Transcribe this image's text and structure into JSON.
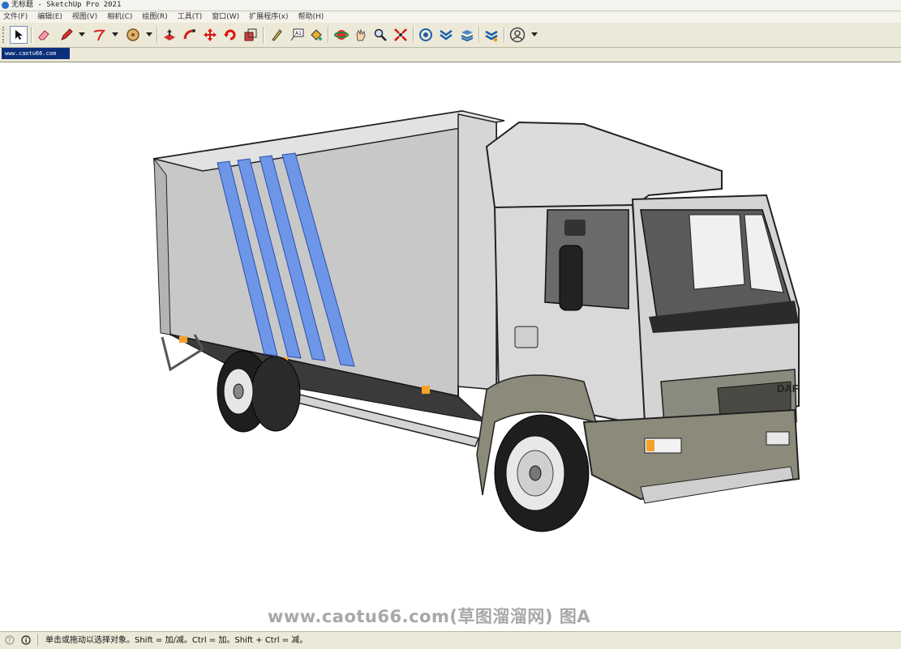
{
  "window": {
    "title": "无标题 - SketchUp Pro 2021"
  },
  "menu": [
    "文件(F)",
    "编辑(E)",
    "视图(V)",
    "相机(C)",
    "绘图(R)",
    "工具(T)",
    "窗口(W)",
    "扩展程序(x)",
    "帮助(H)"
  ],
  "toolbar": {
    "tools": [
      "select-icon",
      "eraser-icon",
      "pencil-icon",
      "arc-icon",
      "circle-icon",
      "push-pull-icon",
      "follow-me-icon",
      "move-icon",
      "rotate-icon",
      "scale-icon",
      "tape-measure-icon",
      "text-icon",
      "paint-bucket-icon",
      "orbit-icon",
      "pan-icon",
      "zoom-icon",
      "zoom-extents-icon",
      "warehouse-icon",
      "extension-icon",
      "layers-icon",
      "sync-icon",
      "account-icon"
    ]
  },
  "tabs": {
    "scene_tab": "www.caotu66.com"
  },
  "viewport": {
    "model": "box-truck",
    "brand_badge": "DAF",
    "watermark": "www.caotu66.com(草图溜溜网) 图A"
  },
  "status": {
    "text": "单击或拖动以选择对象。Shift = 加/减。Ctrl = 加。Shift + Ctrl = 减。"
  },
  "colors": {
    "title_tab_bg": "#0b2f7a",
    "stripe_blue": "#6d95e8",
    "ui_bg": "#ece9d8"
  }
}
